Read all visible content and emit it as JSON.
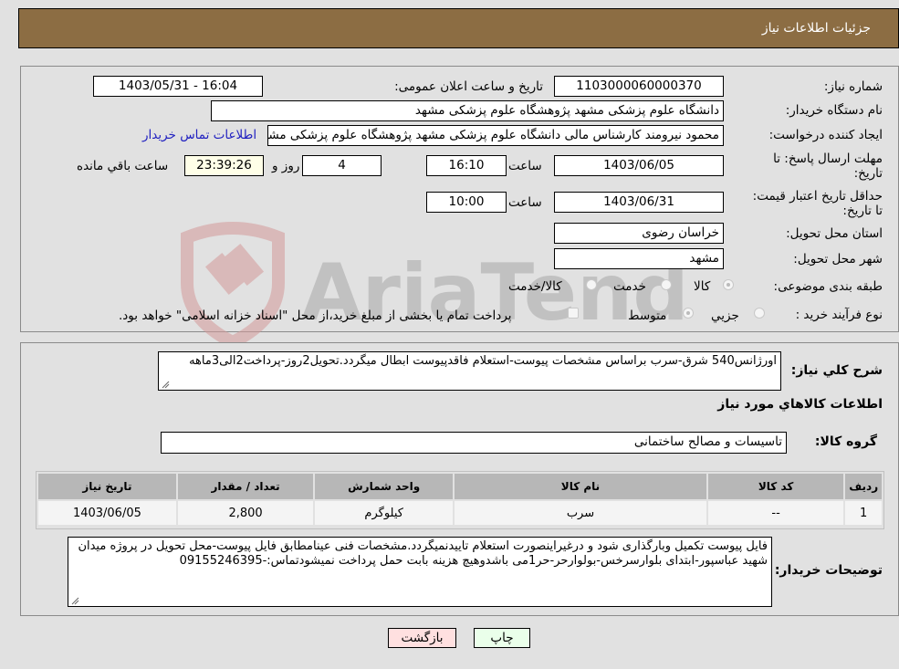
{
  "header": {
    "title": "جزئیات اطلاعات نیاز"
  },
  "info": {
    "need_number_label": "شماره نیاز:",
    "need_number": "1103000060000370",
    "announce_label": "تاریخ و ساعت اعلان عمومی:",
    "announce_value": "1403/05/31 - 16:04",
    "buyer_org_label": "نام دستگاه خریدار:",
    "buyer_org": "دانشگاه علوم پزشکی مشهد   پژوهشگاه علوم پزشکی مشهد",
    "requester_label": "ایجاد کننده درخواست:",
    "requester": "محمود نیرومند کارشناس مالی دانشگاه علوم پزشکی مشهد   پژوهشگاه علوم پزشکی مشهد",
    "contact_link": "اطلاعات تماس خریدار",
    "deadline_label": "مهلت ارسال پاسخ: تا تاریخ:",
    "deadline_date": "1403/06/05",
    "time_label": "ساعت",
    "deadline_time": "16:10",
    "days_remaining": "4",
    "days_label": "روز و",
    "time_remaining": "23:39:26",
    "time_remaining_label": "ساعت باقي مانده",
    "price_validity_label": "حداقل تاریخ اعتبار قیمت: تا تاریخ:",
    "price_validity_date": "1403/06/31",
    "price_validity_time": "10:00",
    "province_label": "استان محل تحویل:",
    "province": "خراسان رضوی",
    "city_label": "شهر محل تحویل:",
    "city": "مشهد",
    "category_label": "طبقه بندی موضوعی:",
    "category_options": [
      "کالا",
      "خدمت",
      "کالا/خدمت"
    ],
    "category_selected": "کالا",
    "process_label": "نوع فرآیند خرید :",
    "process_options": [
      "جزيي",
      "متوسط"
    ],
    "process_selected": "متوسط",
    "treasury_note": "پرداخت تمام یا بخشی از مبلغ خرید،از محل \"اسناد خزانه اسلامی\" خواهد بود."
  },
  "details": {
    "description_label": "شرح کلي نياز:",
    "description": "اورژانس540 شرق-سرب براساس مشخصات پیوست-استعلام فاقدپیوست ابطال میگردد.تحویل2روز-پرداخت2الی3ماهه",
    "items_heading": "اطلاعات کالاهاي مورد نياز",
    "group_label": "گروه کالا:",
    "group_value": "تاسیسات و مصالح ساختمانی",
    "table": {
      "headers": [
        "ردیف",
        "کد کالا",
        "نام کالا",
        "واحد شمارش",
        "تعداد / مقدار",
        "تاریخ نیاز"
      ],
      "rows": [
        [
          "1",
          "--",
          "سرب",
          "کیلوگرم",
          "2,800",
          "1403/06/05"
        ]
      ]
    },
    "buyer_notes_label": "توضیحات خریدار:",
    "buyer_notes": "فایل پیوست تکمیل وبارگذاری شود و درغیراینصورت استعلام تاییدنمیگردد.مشخصات فنی عینامطابق فایل پیوست-محل تحویل در پروژه میدان شهید عباسپور-ابتدای بلوارسرخس-بولوارحر-حر1می باشدوهیچ هزینه بابت حمل  پرداخت نمیشودتماس:-09155246395"
  },
  "buttons": {
    "print": "چاپ",
    "back": "بازگشت"
  },
  "watermark": {
    "text": "AriaTender.neT"
  },
  "colors": {
    "header_bg": "#8c6d43",
    "print_bg": "#eaffea",
    "back_bg": "#ffe0e0",
    "link": "#2020c0"
  }
}
